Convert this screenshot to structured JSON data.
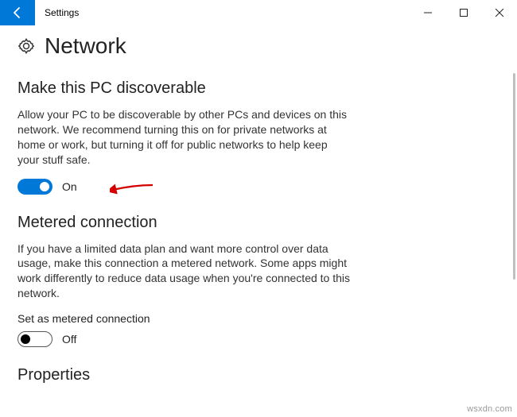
{
  "window": {
    "title": "Settings"
  },
  "page": {
    "heading": "Network"
  },
  "discoverable": {
    "heading": "Make this PC discoverable",
    "body": "Allow your PC to be discoverable by other PCs and devices on this network. We recommend turning this on for private networks at home or work, but turning it off for public networks to help keep your stuff safe.",
    "toggle_state": "On"
  },
  "metered": {
    "heading": "Metered connection",
    "body": "If you have a limited data plan and want more control over data usage, make this connection a metered network. Some apps might work differently to reduce data usage when you're connected to this network.",
    "sub_label": "Set as metered connection",
    "toggle_state": "Off"
  },
  "properties": {
    "heading": "Properties"
  },
  "watermark": "wsxdn.com",
  "colors": {
    "accent": "#0078d7"
  }
}
